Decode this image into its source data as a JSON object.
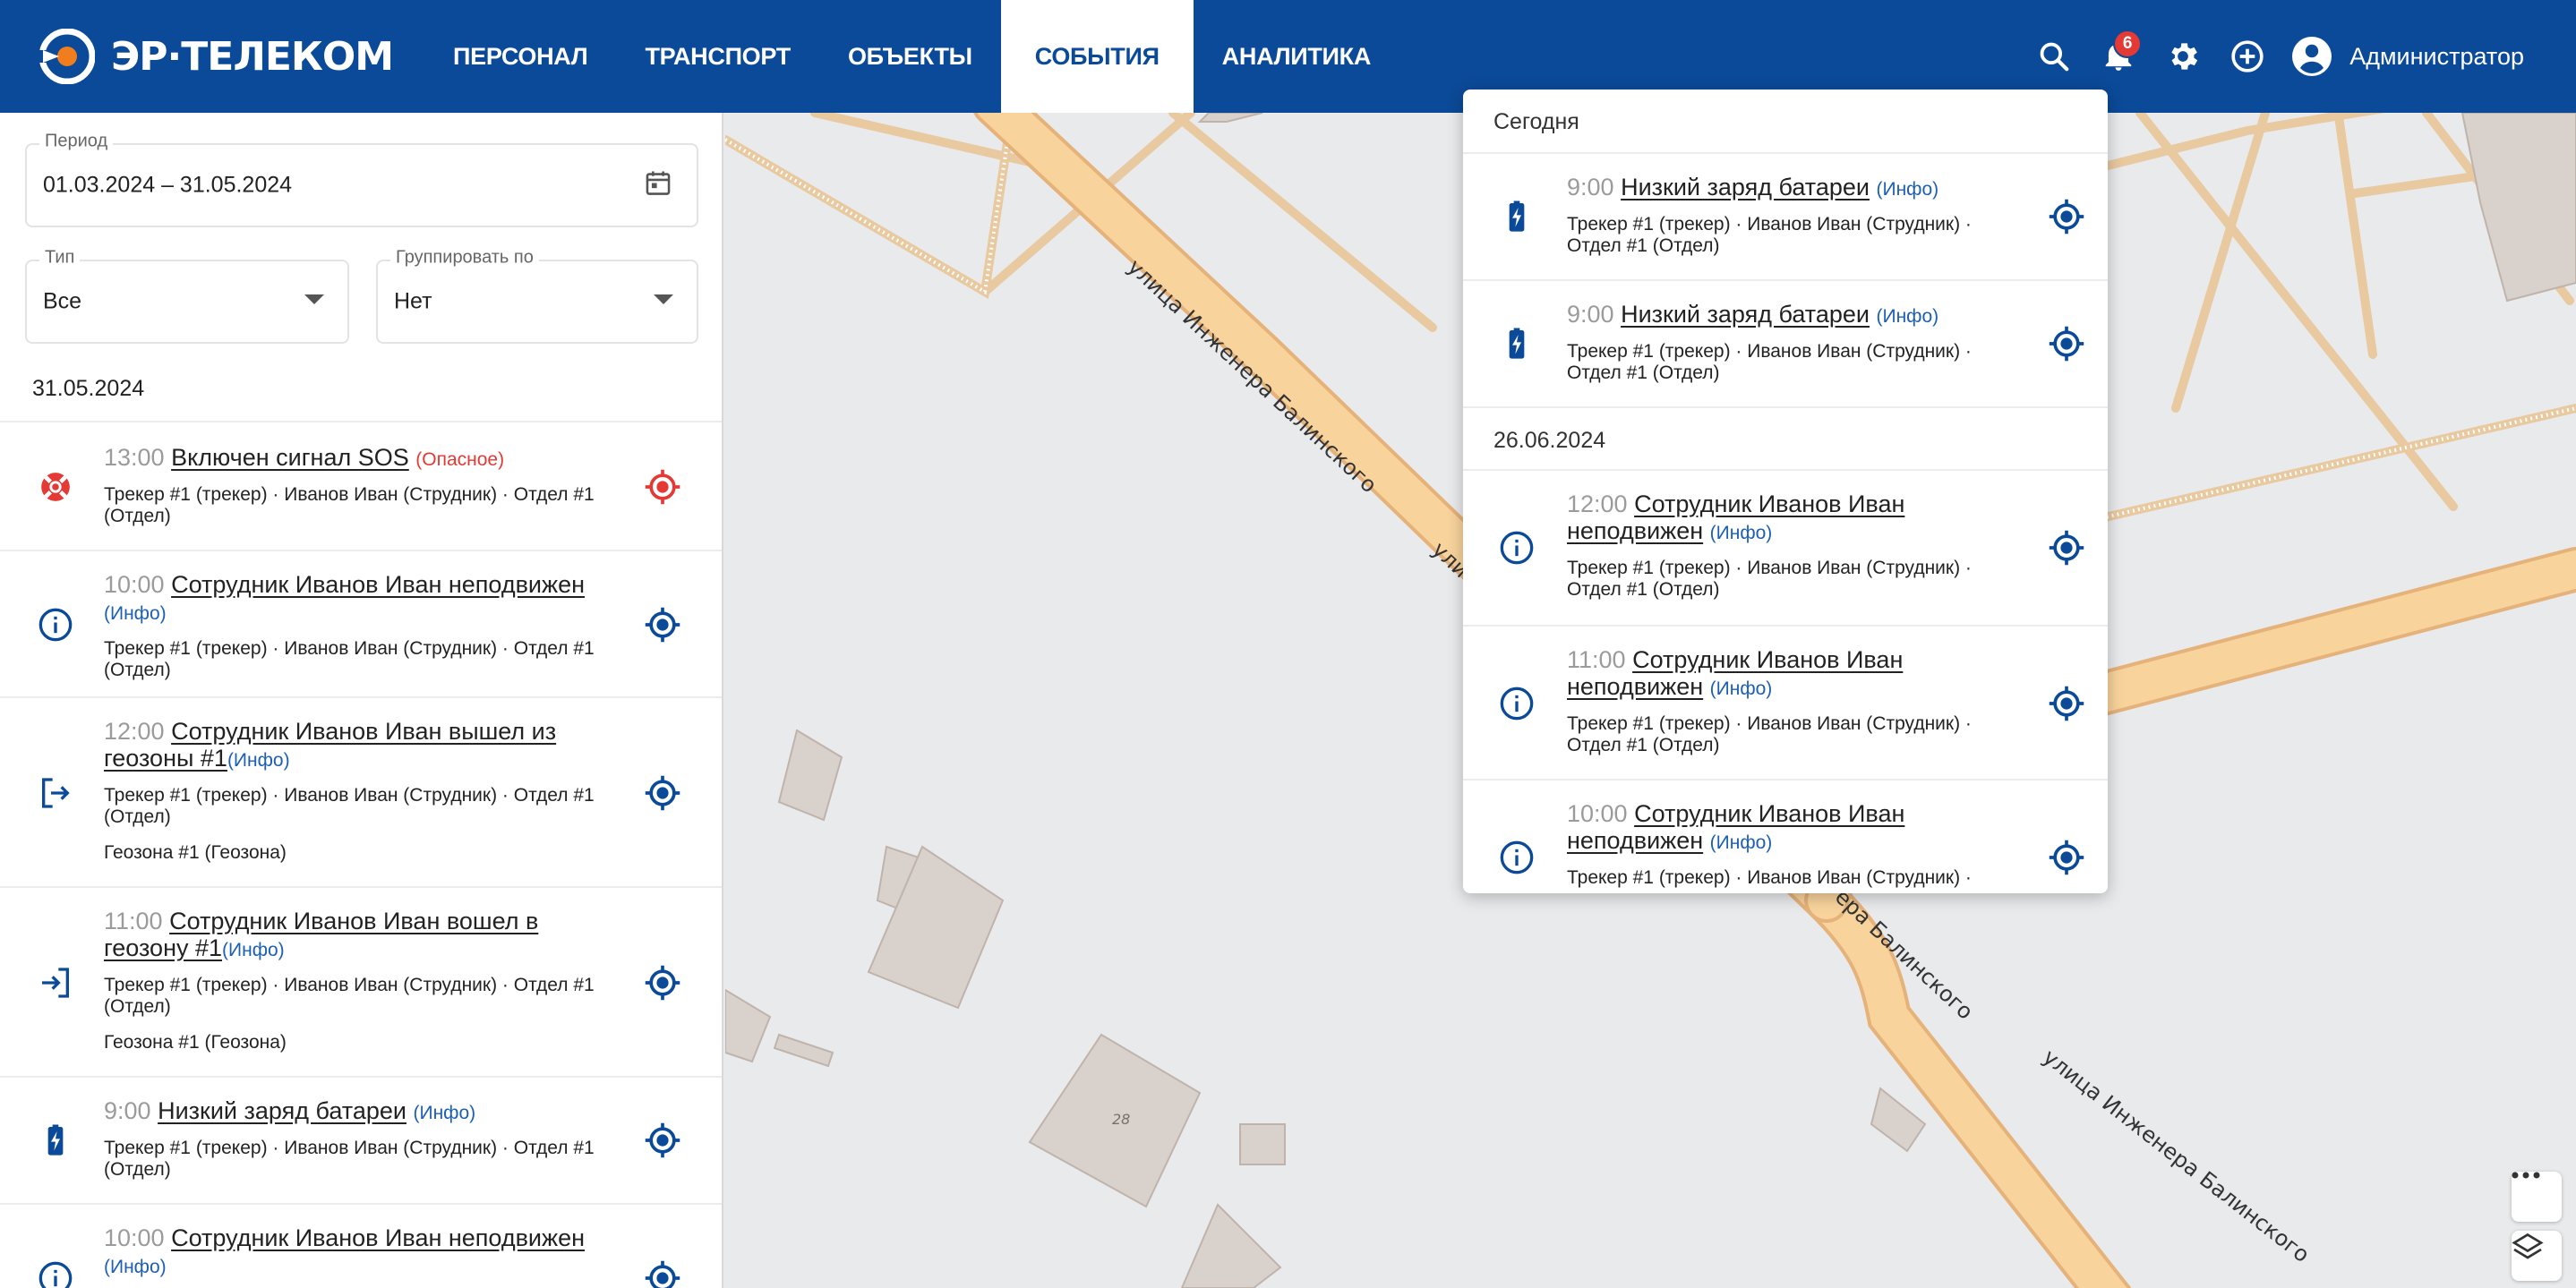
{
  "brand": {
    "name": "ЭР·ТЕЛЕКОМ"
  },
  "nav": {
    "tabs": [
      {
        "label": "ПЕРСОНАЛ"
      },
      {
        "label": "ТРАНСПОРТ"
      },
      {
        "label": "ОБЪЕКТЫ"
      },
      {
        "label": "СОБЫТИЯ"
      },
      {
        "label": "АНАЛИТИКА"
      }
    ],
    "active": "СОБЫТИЯ"
  },
  "header": {
    "notifications_count": "6",
    "user_name": "Администратор",
    "icons": [
      "search-icon",
      "bell-icon",
      "gear-icon",
      "add-circle-icon",
      "account-icon"
    ]
  },
  "filters": {
    "period_label": "Период",
    "period_value": "01.03.2024 – 31.05.2024",
    "type_label": "Тип",
    "type_value": "Все",
    "group_label": "Группировать по",
    "group_value": "Нет"
  },
  "events_date": "31.05.2024",
  "events": [
    {
      "time": "13:00",
      "name": "Включен сигнал SOS",
      "tag": "(Опасное)",
      "meta": "Трекер #1 (трекер) · Иванов Иван (Струдник) · Отдел #1 (Отдел)",
      "icon": "sos-lifebuoy-icon"
    },
    {
      "time": "10:00",
      "name": "Сотрудник Иванов Иван неподвижен",
      "tag": "(Инфо)",
      "meta": "Трекер #1 (трекер) · Иванов Иван (Струдник) · Отдел #1 (Отдел)",
      "icon": "info-icon"
    },
    {
      "time": "12:00",
      "name": "Сотрудник Иванов Иван вышел из геозоны #1",
      "tag": "(Инфо)",
      "meta": "Трекер #1 (трекер) · Иванов Иван (Струдник) · Отдел #1 (Отдел)",
      "geo": "Геозона #1 (Геозона)",
      "icon": "logout-icon"
    },
    {
      "time": "11:00",
      "name": "Сотрудник Иванов Иван вошел в геозону #1",
      "tag": "(Инфо)",
      "meta": "Трекер #1 (трекер) · Иванов Иван (Струдник) · Отдел #1 (Отдел)",
      "geo": "Геозона #1 (Геозона)",
      "icon": "login-icon"
    },
    {
      "time": "9:00",
      "name": "Низкий заряд батареи",
      "tag": "(Инфо)",
      "meta": "Трекер #1 (трекер) · Иванов Иван (Струдник) · Отдел #1 (Отдел)",
      "icon": "battery-charging-icon"
    },
    {
      "time": "10:00",
      "name": "Сотрудник Иванов Иван неподвижен",
      "tag": "(Инфо)",
      "meta": "",
      "icon": "info-icon"
    }
  ],
  "popup": {
    "groups": [
      {
        "date": "Сегодня"
      },
      {
        "date": "26.06.2024"
      }
    ],
    "items": [
      {
        "time": "9:00",
        "name": "Низкий заряд батареи",
        "tag": "(Инфо)",
        "meta": "Трекер #1 (трекер) · Иванов Иван (Струдник) · Отдел #1 (Отдел)",
        "icon": "battery-charging-icon"
      },
      {
        "time": "9:00",
        "name": "Низкий заряд батареи",
        "tag": "(Инфо)",
        "meta": "Трекер #1 (трекер) · Иванов Иван (Струдник) · Отдел #1 (Отдел)",
        "icon": "battery-charging-icon"
      },
      {
        "time": "12:00",
        "name": "Сотрудник Иванов Иван неподвижен",
        "tag": "(Инфо)",
        "meta": "Трекер #1 (трекер) · Иванов Иван (Струдник) · Отдел #1 (Отдел)",
        "icon": "info-icon"
      },
      {
        "time": "11:00",
        "name": "Сотрудник Иванов Иван неподвижен",
        "tag": "(Инфо)",
        "meta": "Трекер #1 (трекер) · Иванов Иван (Струдник) · Отдел #1 (Отдел)",
        "icon": "info-icon"
      },
      {
        "time": "10:00",
        "name": "Сотрудник Иванов Иван неподвижен",
        "tag": "(Инфо)",
        "meta": "Трекер #1 (трекер) · Иванов Иван (Струдник) ·",
        "icon": "info-icon"
      }
    ]
  },
  "map": {
    "street_labels": [
      "улица Инженера Балинского",
      "ули",
      "ера Балинского",
      "улица Инженера Балинского"
    ],
    "house_number": "28",
    "controls": [
      "more-icon",
      "layers-icon"
    ]
  },
  "colors": {
    "brand": "#0b4a98",
    "danger": "#e53935",
    "info": "#1c5fb5",
    "road": "#f8d39c"
  }
}
